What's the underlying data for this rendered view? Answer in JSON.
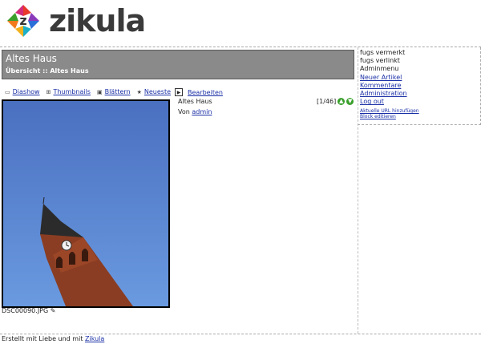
{
  "logo": {
    "text": "zikula"
  },
  "header": {
    "title": "Altes Haus",
    "breadcrumb": "Übersicht :: Altes Haus"
  },
  "toolbar": {
    "slideshow": "Diashow",
    "thumbnails": "Thumbnails",
    "browse": "Blättern",
    "newest": "Neueste"
  },
  "edit": {
    "label": "Bearbeiten"
  },
  "photo": {
    "title": "Altes Haus",
    "counter": "[1/46]",
    "byline_prefix": "Von",
    "author": "admin",
    "filename": "DSC00090.JPG"
  },
  "sidebar": {
    "items": [
      "fugs vermerkt",
      "fugs verlinkt",
      "Adminmenu"
    ],
    "links": [
      "Neuer Artikel",
      "Kommentare",
      "Administration",
      "Log out"
    ],
    "small_links": [
      "Aktuelle URL hinzufügen",
      "Block editieren"
    ]
  },
  "footer": {
    "text": "Erstellt mit Liebe und mit",
    "link": "Zikula"
  },
  "colors": {
    "header_bg": "#8a8a8a",
    "link": "#1a2fa6",
    "sky": "#4f7fc8"
  }
}
